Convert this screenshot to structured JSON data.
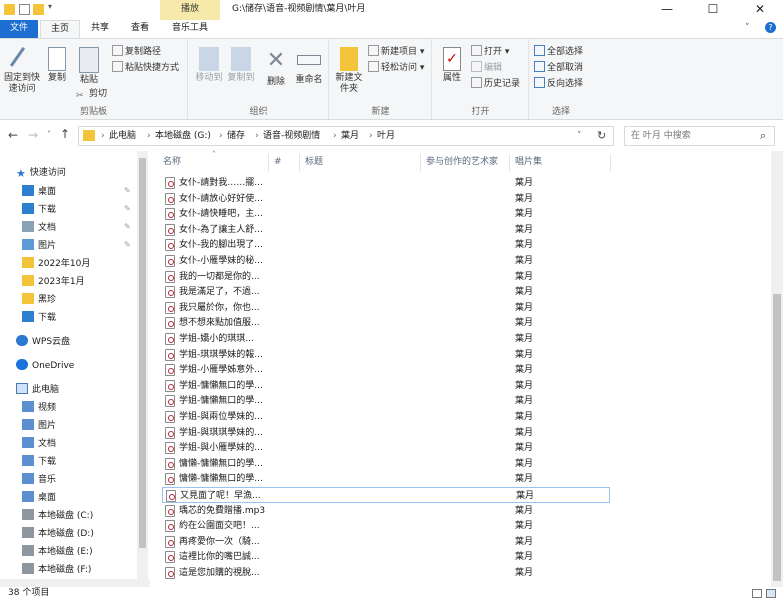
{
  "window": {
    "title": "G:\\储存\\语音-视频剧情\\葉月\\叶月",
    "context_tab": "播放",
    "minimize": "—",
    "maximize": "☐",
    "close": "✕",
    "help": "?"
  },
  "tabs": {
    "file": "文件",
    "home": "主页",
    "share": "共享",
    "view": "查看",
    "music_tools": "音乐工具"
  },
  "ribbon": {
    "clipboard": {
      "label": "剪贴板",
      "pin": "固定到快速访问",
      "copy": "复制",
      "paste": "粘贴",
      "copy_path": "复制路径",
      "paste_shortcut": "粘贴快捷方式",
      "cut": "剪切"
    },
    "organize": {
      "label": "组织",
      "move_to": "移动到",
      "copy_to": "复制到",
      "delete": "删除",
      "rename": "重命名"
    },
    "new": {
      "label": "新建",
      "new_folder": "新建文件夹",
      "new_item": "新建项目",
      "easy_access": "轻松访问"
    },
    "open": {
      "label": "打开",
      "properties": "属性",
      "open": "打开",
      "edit": "编辑",
      "history": "历史记录"
    },
    "select": {
      "label": "选择",
      "select_all": "全部选择",
      "select_none": "全部取消",
      "invert": "反向选择"
    }
  },
  "address": {
    "crumbs": [
      "此电脑",
      "本地磁盘 (G:)",
      "储存",
      "语音-视频剧情",
      "葉月",
      "叶月"
    ],
    "search_placeholder": "在 叶月 中搜索"
  },
  "nav": {
    "quick_access": "快速访问",
    "items": [
      {
        "label": "桌面",
        "pinned": true
      },
      {
        "label": "下载",
        "pinned": true
      },
      {
        "label": "文档",
        "pinned": true
      },
      {
        "label": "图片",
        "pinned": true
      },
      {
        "label": "2022年10月"
      },
      {
        "label": "2023年1月"
      },
      {
        "label": "黑珍"
      },
      {
        "label": "下载"
      }
    ],
    "wps": "WPS云盘",
    "onedrive": "OneDrive",
    "this_pc": "此电脑",
    "pc_items": [
      "视频",
      "图片",
      "文档",
      "下载",
      "音乐",
      "桌面",
      "本地磁盘 (C:)",
      "本地磁盘 (D:)",
      "本地磁盘 (E:)",
      "本地磁盘 (F:)"
    ]
  },
  "columns": {
    "name": "名称",
    "num": "#",
    "title": "标题",
    "artist": "参与创作的艺术家",
    "album": "唱片集"
  },
  "files": [
    {
      "name": "女仆-請對我……擺...",
      "album": "葉月"
    },
    {
      "name": "女仆-請放心好好使...",
      "album": "葉月"
    },
    {
      "name": "女仆-請快睡吧，主...",
      "album": "葉月"
    },
    {
      "name": "女仆-為了讓主人舒...",
      "album": "葉月"
    },
    {
      "name": "女仆-我的腳出現了...",
      "album": "葉月"
    },
    {
      "name": "女仆-小雁學妹的秘...",
      "album": "葉月"
    },
    {
      "name": "我的一切都是你的...",
      "album": "葉月"
    },
    {
      "name": "我是滿足了，不過...",
      "album": "葉月"
    },
    {
      "name": "我只屬於你，你也...",
      "album": "葉月"
    },
    {
      "name": "想不想來點加值服...",
      "album": "葉月"
    },
    {
      "name": "学姐-嬌小的琪琪...",
      "album": "葉月"
    },
    {
      "name": "学姐-琪琪學妹的報...",
      "album": "葉月"
    },
    {
      "name": "学姐-小雁學姊意外...",
      "album": "葉月"
    },
    {
      "name": "学姐-慵懶無口的學...",
      "album": "葉月"
    },
    {
      "name": "学姐-慵懶無口的學...",
      "album": "葉月"
    },
    {
      "name": "学姐-與兩位學妹的...",
      "album": "葉月"
    },
    {
      "name": "学姐-與琪琪學妹的...",
      "album": "葉月"
    },
    {
      "name": "学姐-與小雁學妹的...",
      "album": "葉月"
    },
    {
      "name": "慵懶-慵懶無口的學...",
      "album": "葉月"
    },
    {
      "name": "慵懶-慵懶無口的學...",
      "album": "葉月"
    },
    {
      "name": "又見面了呢！早漁...",
      "album": "葉月"
    },
    {
      "name": "瑀芯的免費贈播.mp3",
      "album": "葉月"
    },
    {
      "name": "約在公園面交吧！...",
      "album": "葉月"
    },
    {
      "name": "再疼愛你一次（騎...",
      "album": "葉月"
    },
    {
      "name": "這裡比你的嘴巴誠...",
      "album": "葉月"
    },
    {
      "name": "這是您加購的視脫...",
      "album": "葉月"
    }
  ],
  "status": {
    "count": "38 个项目"
  }
}
